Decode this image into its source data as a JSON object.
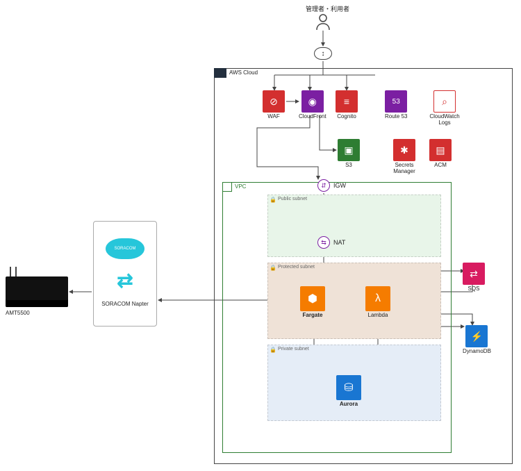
{
  "actor": {
    "label": "管理者・利用者"
  },
  "aws": {
    "label": "AWS Cloud",
    "services_row1": [
      {
        "name": "waf",
        "label": "WAF",
        "glyph": "⊘",
        "color": "red"
      },
      {
        "name": "cloudfront",
        "label": "CloudFront",
        "glyph": "◉",
        "color": "purple"
      },
      {
        "name": "cognito",
        "label": "Cognito",
        "glyph": "≡",
        "color": "red"
      },
      {
        "name": "route53",
        "label": "Route 53",
        "glyph": "53",
        "color": "purple"
      },
      {
        "name": "cwlogs",
        "label": "CloudWatch Logs",
        "glyph": "⌕",
        "color": "outline-red"
      }
    ],
    "services_row2": [
      {
        "name": "s3",
        "label": "S3",
        "glyph": "▣",
        "color": "green"
      },
      {
        "name": "secrets",
        "label": "Secrets Manager",
        "glyph": "✱",
        "color": "red"
      },
      {
        "name": "acm",
        "label": "ACM",
        "glyph": "▤",
        "color": "red"
      }
    ],
    "igw_label": "IGW",
    "nat_label": "NAT"
  },
  "vpc": {
    "label": "VPC",
    "public_label": "Public subnet",
    "protected_label": "Protected subnet",
    "private_label": "Private subnet",
    "fargate_label": "Fargate",
    "lambda_label": "Lambda",
    "aurora_label": "Aurora"
  },
  "right": {
    "sqs_label": "SQS",
    "dynamo_label": "DynamoDB"
  },
  "soracom": {
    "cloud_text": "SORACOM",
    "label": "SORACOM Napter"
  },
  "device": {
    "label": "AMT5500"
  },
  "chart_data": {
    "type": "diagram",
    "title": "AWS architecture with SORACOM Napter remote device access",
    "actors": [
      "管理者・利用者"
    ],
    "external_components": [
      "AMT5500",
      "SORACOM Napter"
    ],
    "aws_global_services": [
      "WAF",
      "CloudFront",
      "Cognito",
      "Route 53",
      "CloudWatch Logs",
      "S3",
      "Secrets Manager",
      "ACM"
    ],
    "aws_regional_services": [
      "SQS",
      "DynamoDB"
    ],
    "vpc": {
      "gateways": [
        "IGW",
        "NAT"
      ],
      "public_subnet": [],
      "protected_subnet": [
        "Fargate",
        "Lambda"
      ],
      "private_subnet": [
        "Aurora"
      ]
    },
    "edges": [
      [
        "管理者・利用者",
        "CloudFront"
      ],
      [
        "管理者・利用者",
        "Cognito"
      ],
      [
        "管理者・利用者",
        "WAF"
      ],
      [
        "WAF",
        "CloudFront"
      ],
      [
        "CloudFront",
        "S3"
      ],
      [
        "CloudFront",
        "IGW"
      ],
      [
        "IGW",
        "NAT"
      ],
      [
        "NAT",
        "Fargate"
      ],
      [
        "NAT",
        "Lambda"
      ],
      [
        "Fargate",
        "Lambda"
      ],
      [
        "Fargate",
        "Aurora"
      ],
      [
        "Lambda",
        "Aurora"
      ],
      [
        "Fargate",
        "SQS"
      ],
      [
        "Lambda",
        "SQS"
      ],
      [
        "Fargate",
        "DynamoDB"
      ],
      [
        "Lambda",
        "DynamoDB"
      ],
      [
        "Fargate",
        "SORACOM Napter"
      ],
      [
        "SORACOM Napter",
        "AMT5500"
      ]
    ]
  }
}
